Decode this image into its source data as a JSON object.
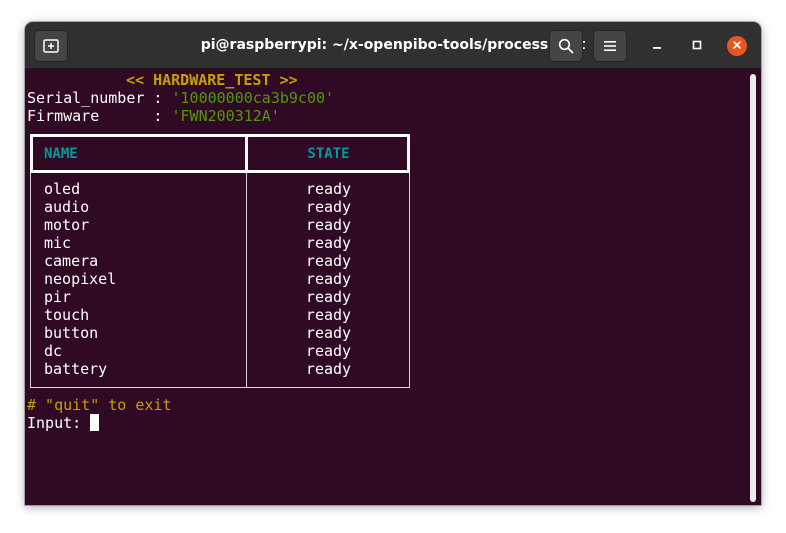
{
  "window": {
    "title": "pi@raspberrypi: ~/x-openpibo-tools/process-test"
  },
  "titlebar": {
    "icons": {
      "new_tab": "new-tab-icon",
      "search": "search-icon",
      "menu": "hamburger-menu-icon",
      "minimize": "minimize-icon",
      "maximize": "maximize-icon",
      "close": "close-icon"
    }
  },
  "colors": {
    "terminal_bg": "#300a24",
    "titlebar_bg": "#303030",
    "yellow": "#c4a000",
    "green": "#4e9a06",
    "teal": "#06989a",
    "close_button": "#e95420"
  },
  "terminal": {
    "header": "<< HARDWARE_TEST >>",
    "serial_label": "Serial_number : ",
    "serial_value": "'10000000ca3b9c00'",
    "firmware_label": "Firmware      : ",
    "firmware_value": "'FWN200312A'",
    "table": {
      "columns": [
        "NAME",
        "STATE"
      ],
      "rows": [
        {
          "name": "oled",
          "state": "ready"
        },
        {
          "name": "audio",
          "state": "ready"
        },
        {
          "name": "motor",
          "state": "ready"
        },
        {
          "name": "mic",
          "state": "ready"
        },
        {
          "name": "camera",
          "state": "ready"
        },
        {
          "name": "neopixel",
          "state": "ready"
        },
        {
          "name": "pir",
          "state": "ready"
        },
        {
          "name": "touch",
          "state": "ready"
        },
        {
          "name": "button",
          "state": "ready"
        },
        {
          "name": "dc",
          "state": "ready"
        },
        {
          "name": "battery",
          "state": "ready"
        }
      ]
    },
    "hint": "# \"quit\" to exit",
    "prompt": "Input: "
  }
}
